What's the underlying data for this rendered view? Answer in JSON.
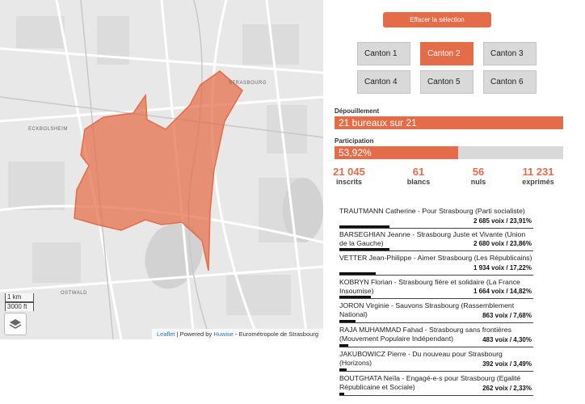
{
  "map": {
    "places": [
      "ECKBOLSHEIM",
      "STRASBOURG",
      "OSTWALD"
    ],
    "scale_km": "1 km",
    "scale_ft": "3000 ft",
    "attribution": {
      "leaflet": "Leaflet",
      "powered": "| Powered by",
      "huwise": "Huwise",
      "source": "- Eurométropole de Strasbourg"
    },
    "highlight_color": "#e46c48"
  },
  "clear_button": "Effacer la sélection",
  "cantons": [
    {
      "label": "Canton 1",
      "active": false
    },
    {
      "label": "Canton 2",
      "active": true
    },
    {
      "label": "Canton 3",
      "active": false
    },
    {
      "label": "Canton 4",
      "active": false
    },
    {
      "label": "Canton 5",
      "active": false
    },
    {
      "label": "Canton 6",
      "active": false
    }
  ],
  "depouillement": {
    "label": "Dépouillement",
    "text": "21 bureaux sur 21",
    "fraction": 1.0
  },
  "participation": {
    "label": "Participation",
    "text": "53,92%",
    "fraction": 0.5392
  },
  "stats": [
    {
      "value": "21 045",
      "label": "inscrits"
    },
    {
      "value": "61",
      "label": "blancs"
    },
    {
      "value": "56",
      "label": "nuls"
    },
    {
      "value": "11 231",
      "label": "exprimés"
    }
  ],
  "candidates": [
    {
      "name": "TRAUTMANN Catherine - Pour Strasbourg (Parti socialiste)",
      "result": "2 685 voix /  23,91%",
      "share": 0.2391
    },
    {
      "name": "BARSEGHIAN Jeanne - Strasbourg Juste et Vivante (Union de la Gauche)",
      "result": "2 680 voix /  23,86%",
      "share": 0.2386
    },
    {
      "name": "VETTER Jean-Philippe - Aimer Strasbourg (Les Républicains)",
      "result": "1 934 voix /  17,22%",
      "share": 0.1722
    },
    {
      "name": "KOBRYN Florian - Strasbourg fière et solidaire (La France Insoumise)",
      "result": "1 664 voix /  14,82%",
      "share": 0.1482
    },
    {
      "name": "JORON Virginie - Sauvons Strasbourg (Rassemblement National)",
      "result": "863 voix /  7,68%",
      "share": 0.0768
    },
    {
      "name": "RAJA MUHAMMAD Fahad - Strasbourg sans frontières (Mouvement Populaire Indépendant)",
      "result": "483 voix /  4,30%",
      "share": 0.043
    },
    {
      "name": "JAKUBOWICZ Pierre - Du nouveau pour Strasbourg (Horizons)",
      "result": "392 voix /  3,49%",
      "share": 0.0349
    },
    {
      "name": "BOUTGHATA Neïla - Engagé-e-s pour Strasbourg (Egalité Républicaine et Sociale)",
      "result": "262 voix /  2,33%",
      "share": 0.0233
    }
  ]
}
